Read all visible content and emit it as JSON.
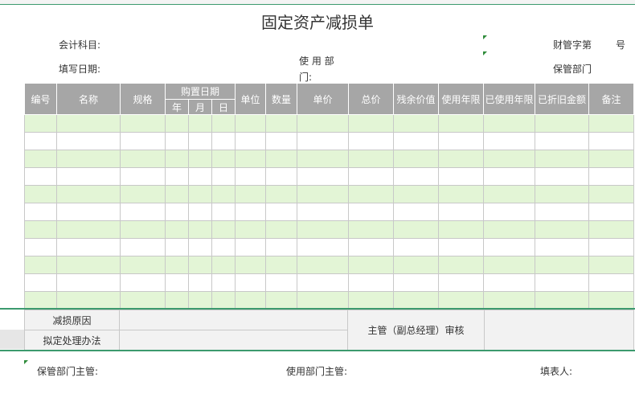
{
  "title": "固定资产减损单",
  "header": {
    "account_subject": "会计科目:",
    "fill_date": "填写日期:",
    "use_dept": "使  用  部",
    "use_dept_cont": "门:",
    "finance_no_prefix": "财管字第",
    "finance_no_suffix": "号",
    "custody_dept": "保管部门"
  },
  "table": {
    "headers": {
      "no": "编号",
      "name": "名称",
      "spec": "规格",
      "purchase_date": "购置日期",
      "year": "年",
      "month": "月",
      "day": "日",
      "unit": "单位",
      "qty": "数量",
      "unit_price": "单价",
      "total": "总价",
      "residual": "残余价值",
      "service_life": "使用年限",
      "used_years": "已使用年限",
      "depreciated": "已折旧金额",
      "remark": "备注"
    }
  },
  "bottom": {
    "reason": "减损原因",
    "disposal_plan": "拟定处理办法",
    "supervisor_review": "主管（副总经理）审核"
  },
  "footer": {
    "custody_head": "保管部门主管:",
    "use_dept_head": "使用部门主管:",
    "filler": "填表人:"
  },
  "colors": {
    "header_bg": "#a6a6a6",
    "stripe_green": "#e3f5d6",
    "accent_green": "#3c9a6e"
  }
}
